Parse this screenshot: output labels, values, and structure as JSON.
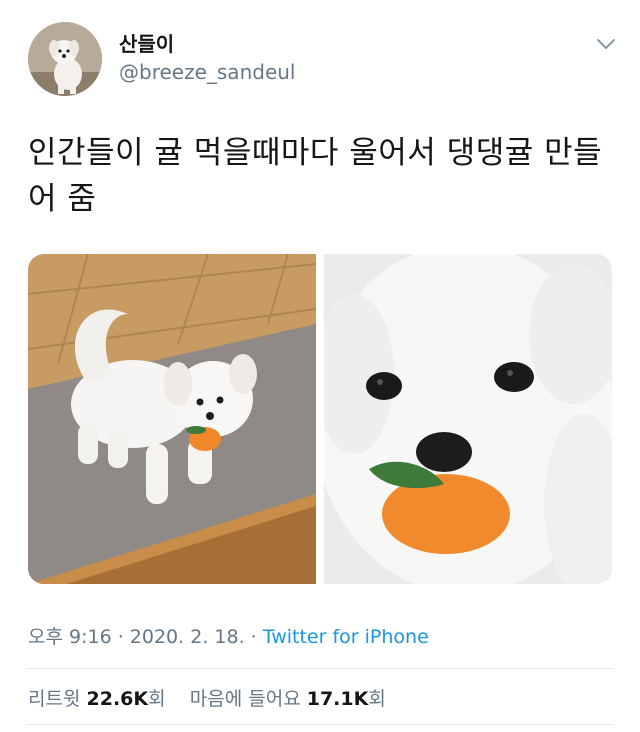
{
  "user": {
    "display_name": "산들이",
    "handle": "@breeze_sandeul",
    "avatar_icon": "dog-avatar"
  },
  "header": {
    "more_icon": "chevron-down-icon"
  },
  "tweet": {
    "text": "인간들이 귤 먹을때마다 울어서 댕댕귤 만들어 줌"
  },
  "media": [
    {
      "name": "photo-dog-standing-with-toy"
    },
    {
      "name": "photo-dog-closeup-with-toy"
    }
  ],
  "meta": {
    "time": "오후 9:16",
    "separator1": " · ",
    "date": "2020. 2. 18.",
    "separator2": " · ",
    "source": "Twitter for iPhone"
  },
  "stats": {
    "retweets_label": "리트윗",
    "retweets_count": "22.6K",
    "retweets_suffix": "회",
    "likes_label": "마음에 들어요",
    "likes_count": "17.1K",
    "likes_suffix": "회"
  },
  "colors": {
    "text_primary": "#14171a",
    "text_secondary": "#657786",
    "link": "#1b95e0",
    "divider": "#e1e8ed"
  }
}
